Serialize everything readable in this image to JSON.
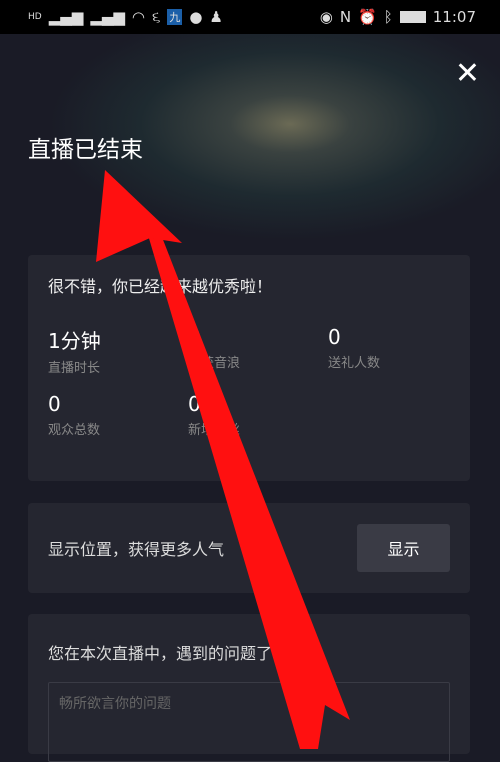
{
  "status_bar": {
    "left_icons": [
      "hd-icon",
      "signal-icon",
      "signal-icon",
      "wifi-icon",
      "app-icon",
      "app-icon",
      "chat-icon",
      "qq-icon"
    ],
    "right_icons": [
      "eye-icon",
      "nfc-icon",
      "alarm-icon",
      "bluetooth-icon",
      "battery-icon"
    ],
    "time": "11:07"
  },
  "header": {
    "close": "✕",
    "title": "直播已结束"
  },
  "summary": {
    "message": "很不错，你已经越来越优秀啦！",
    "stats": [
      {
        "value": "1分钟",
        "label": "直播时长"
      },
      {
        "value": "0",
        "label": "收获音浪"
      },
      {
        "value": "0",
        "label": "送礼人数"
      },
      {
        "value": "0",
        "label": "观众总数"
      },
      {
        "value": "0",
        "label": "新增粉丝"
      }
    ]
  },
  "location": {
    "text": "显示位置，获得更多人气",
    "button": "显示"
  },
  "feedback": {
    "question": "您在本次直播中，遇到的问题了吗？",
    "placeholder": "畅所欲言你的问题"
  },
  "annotation": {
    "color": "#ff1010"
  }
}
